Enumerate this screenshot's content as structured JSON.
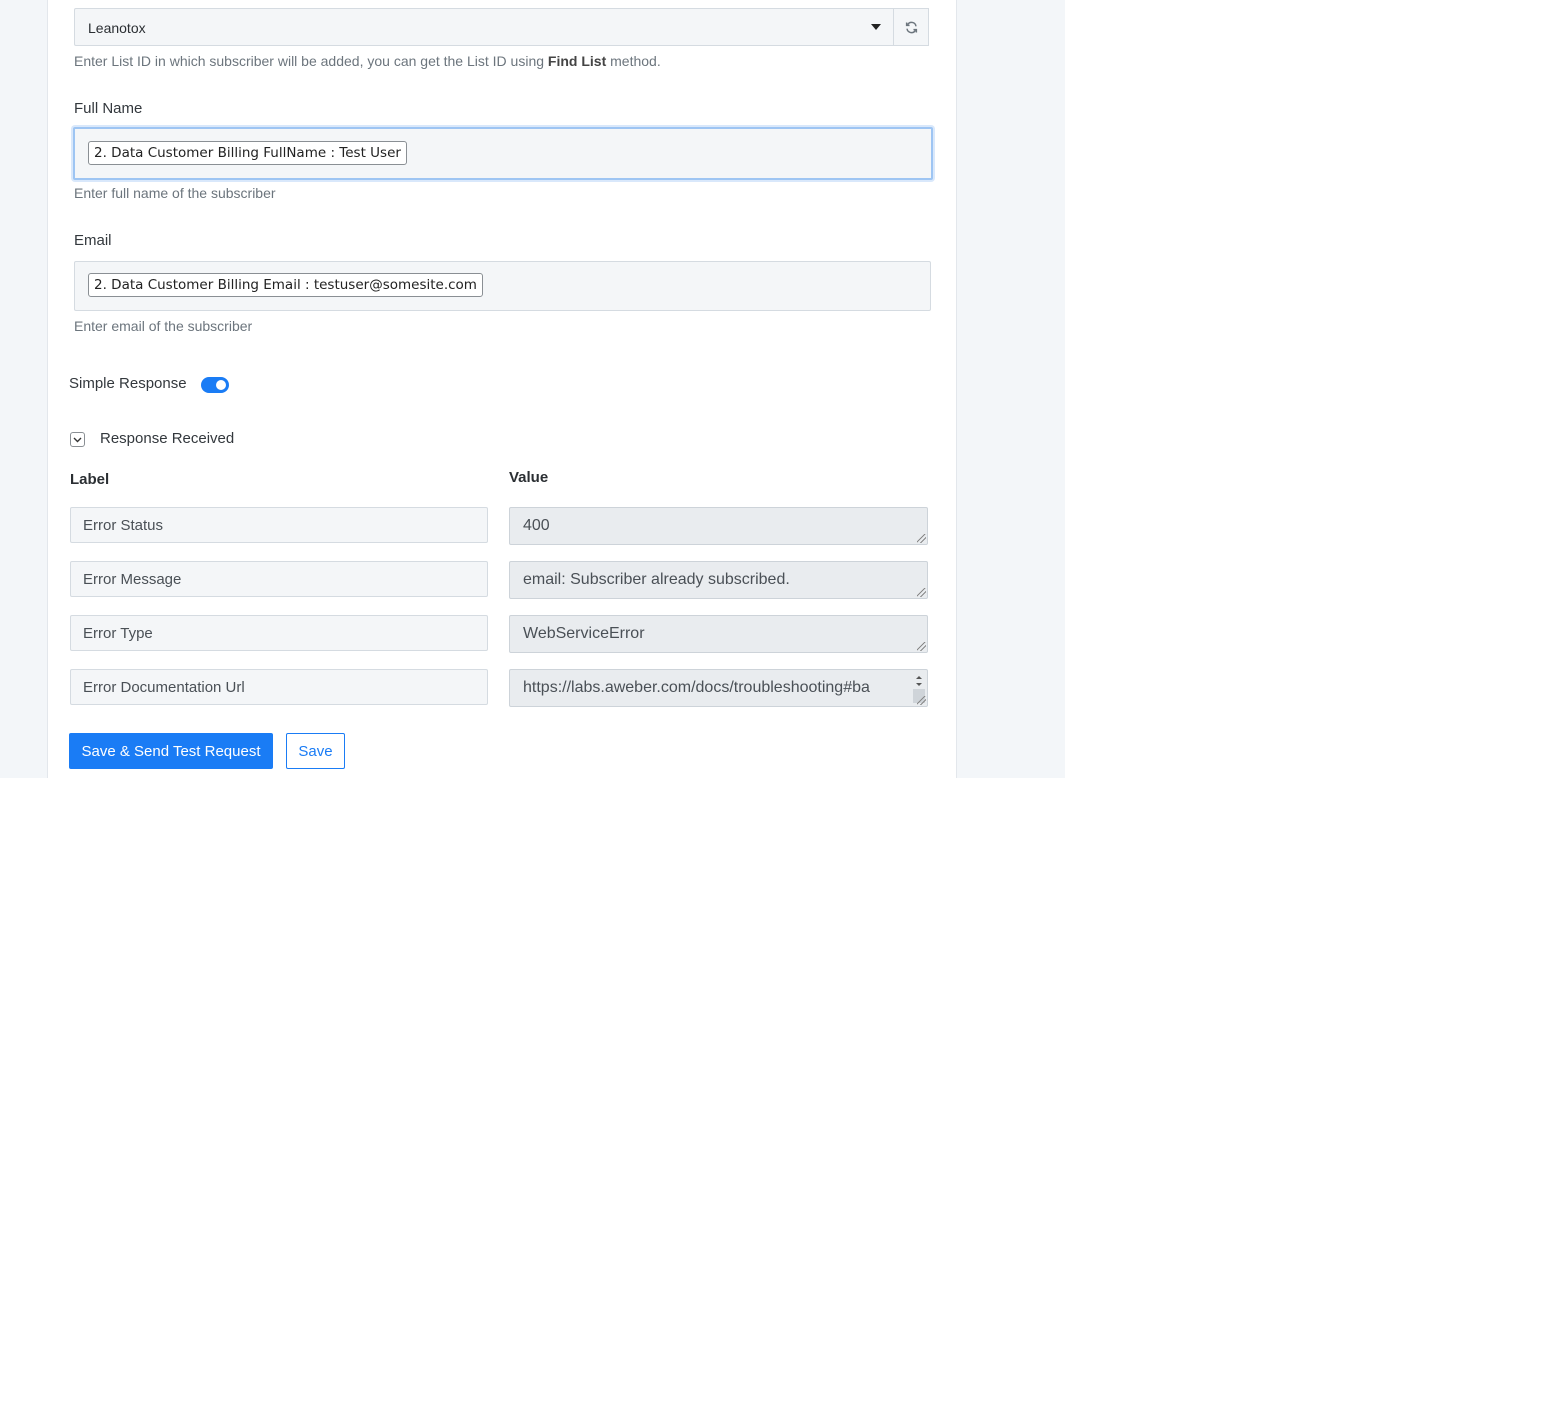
{
  "list": {
    "selected": "Leanotox",
    "help_prefix": "Enter List ID in which subscriber will be added, you can get the List ID using ",
    "help_bold": "Find List",
    "help_suffix": " method."
  },
  "full_name": {
    "label": "Full Name",
    "token": "2. Data Customer Billing FullName : Test User",
    "help": "Enter full name of the subscriber"
  },
  "email": {
    "label": "Email",
    "token": "2. Data Customer Billing Email : testuser@somesite.com",
    "help": "Enter email of the subscriber"
  },
  "simple_response": {
    "label": "Simple Response",
    "enabled": true
  },
  "response_received": {
    "label": "Response Received"
  },
  "table": {
    "label_header": "Label",
    "value_header": "Value",
    "rows": [
      {
        "label": "Error Status",
        "value": "400"
      },
      {
        "label": "Error Message",
        "value": "email: Subscriber already subscribed."
      },
      {
        "label": "Error Type",
        "value": "WebServiceError"
      },
      {
        "label": "Error Documentation Url",
        "value": "https://labs.aweber.com/docs/troubleshooting#ba"
      }
    ]
  },
  "buttons": {
    "save_send": "Save & Send Test Request",
    "save": "Save"
  },
  "colors": {
    "accent": "#1a7cf5",
    "focus_border": "#9ec5f3"
  }
}
